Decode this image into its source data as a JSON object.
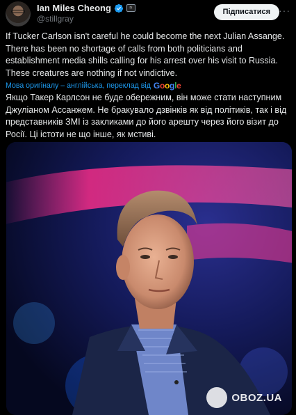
{
  "author": {
    "display_name": "Ian Miles Cheong",
    "handle": "@stillgray",
    "verified_icon": "verified-badge-icon",
    "affiliation_badge": "affiliate-badge-icon"
  },
  "actions": {
    "subscribe_label": "Підписатися",
    "more_icon": "more-options-icon"
  },
  "tweet": {
    "text": "If Tucker Carlson isn't careful he could become the next Julian Assange. There has been no shortage of calls from both politicians and establishment media shills calling for his arrest over his visit to Russia. These creatures are nothing if not vindictive.",
    "translation_note": "Мова оригіналу – англійська, переклад від",
    "translation_provider": "Google",
    "translated_text": "Якщо Такер Карлсон не буде обережним, він може стати наступним Джуліаном Ассанжем. Не бракувало дзвінків як від політиків, так і від представників ЗМІ із закликами до його арешту через його візит до Росії. Ці істоти не що інше, як мстиві."
  },
  "media": {
    "image_description_icon": "tweet-photo",
    "watermark_text": "OBOZ.UA",
    "watermark_icon": "oboz-logo-icon"
  },
  "colors": {
    "background": "#000000",
    "text": "#e7e9ea",
    "muted": "#71767b",
    "link": "#1d9bf0",
    "verified": "#1d9bf0"
  }
}
